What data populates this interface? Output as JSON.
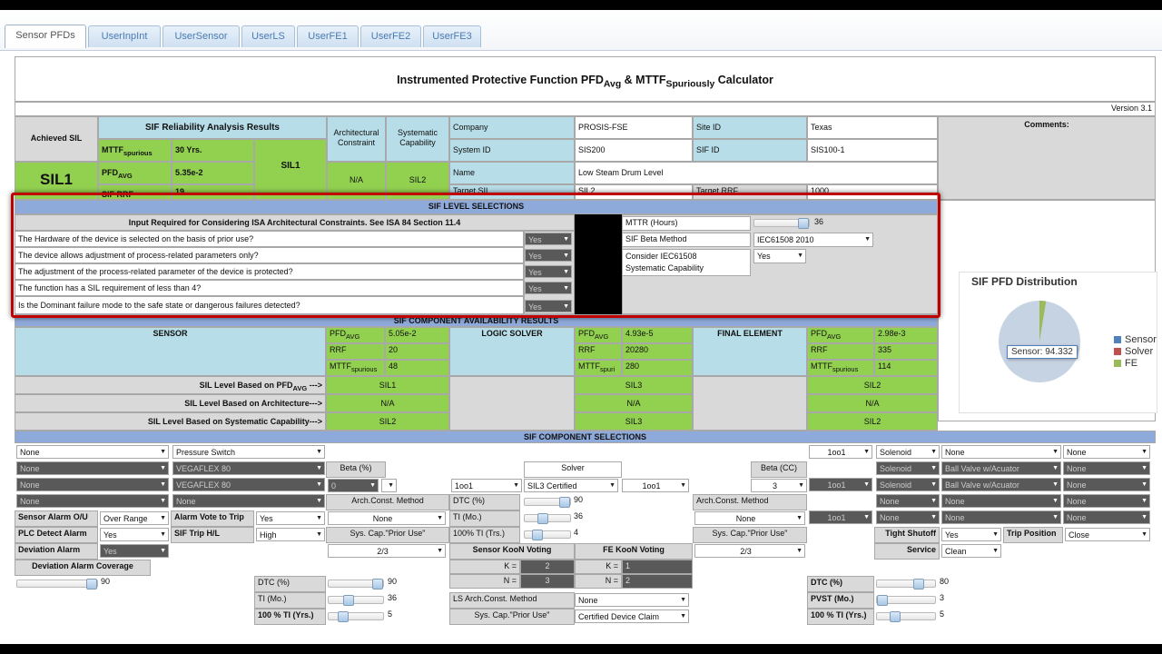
{
  "tabs": [
    "Sensor PFDs",
    "UserInpInt",
    "UserSensor",
    "UserLS",
    "UserFE1",
    "UserFE2",
    "UserFE3"
  ],
  "title": {
    "prefix": "Instrumented Protective Function PFD",
    "sub1": "Avg",
    "mid": " & MTTF",
    "sub2": "Spuriously",
    "suffix": " Calculator"
  },
  "version": "Version 3.1",
  "summary": {
    "achieved_sil_label": "Achieved SIL",
    "achieved_sil": "SIL1",
    "results_label": "SIF Reliability Analysis Results",
    "mttf_label": "MTTF",
    "mttf_sub": "spurious",
    "mttf_value": "30 Yrs.",
    "pfd_label": "PFD",
    "pfd_sub": "AVG",
    "pfd_value": "5.35e-2",
    "sil_value": "SIL1",
    "rrf_label": "SIF RRF",
    "rrf_value": "19",
    "arch_label": "Architectural Constraint",
    "arch_value": "N/A",
    "sys_label": "Systematic Capability",
    "sys_value": "SIL2"
  },
  "info": {
    "company_label": "Company",
    "company": "PROSIS-FSE",
    "site_label": "Site ID",
    "site": "Texas",
    "system_label": "System ID",
    "system": "SIS200",
    "sif_label": "SIF ID",
    "sif": "SIS100-1",
    "name_label": "Name",
    "name": "Low Steam Drum Level",
    "target_label": "Target SIL",
    "target": "SIL2",
    "target_rrf_label": "Target RRF",
    "target_rrf": "1000",
    "comments_label": "Comments:"
  },
  "sel": {
    "header": "SIF LEVEL SELECTIONS",
    "isa_note": "Input Required for Considering ISA Architectural Constraints. See ISA 84  Section 11.4",
    "questions": [
      "The Hardware of the device is selected on the basis of prior use?",
      "The device allows adjustment of process-related parameters only?",
      "The adjustment of the process-related parameter of the device is protected?",
      "The function has a SIL requirement of less than 4?",
      "Is the Dominant failure mode to the safe state or dangerous failures detected?"
    ],
    "answers": [
      "Yes",
      "Yes",
      "Yes",
      "Yes",
      "Yes"
    ],
    "mttr_label": "MTTR (Hours)",
    "mttr": "36",
    "beta_label": "SIF Beta Method",
    "beta": "IEC61508 2010",
    "consider_label1": "Consider IEC61508",
    "consider_label2": "Systematic Capability",
    "consider": "Yes"
  },
  "pie": {
    "title": "SIF PFD Distribution",
    "tooltip": "Sensor: 94.332",
    "legend": [
      {
        "name": "Sensor",
        "color": "#4f81bd"
      },
      {
        "name": "Solver",
        "color": "#c0504d"
      },
      {
        "name": "FE",
        "color": "#9bbb59"
      }
    ]
  },
  "avail": {
    "header": "SIF COMPONENT AVAILABILITY RESULTS",
    "sensor": "SENSOR",
    "solver": "LOGIC SOLVER",
    "fe": "FINAL ELEMENT",
    "pfd": "PFD",
    "pfd_sub": "AVG",
    "rrf": "RRF",
    "mttf": "MTTF",
    "mttf_sub": "spurious",
    "mttf_sub2": "spuri",
    "s_pfd": "5.05e-2",
    "s_rrf": "20",
    "s_mttf": "48",
    "l_pfd": "4.93e-5",
    "l_rrf": "20280",
    "l_mttf": "280",
    "f_pfd": "2.98e-3",
    "f_rrf": "335",
    "f_mttf": "114",
    "row1": "SIL Level Based on PFD",
    "row1_sub": "AVG",
    "row1_tail": " --->",
    "row2": "SIL Level Based on Architecture--->",
    "row3": "SIL Level Based on Systematic Capability--->",
    "s_sil": [
      "SIL1",
      "N/A",
      "SIL2"
    ],
    "l_sil": [
      "SIL3",
      "N/A",
      "SIL3"
    ],
    "f_sil": [
      "SIL2",
      "N/A",
      "SIL2"
    ]
  },
  "comp": {
    "header": "SIF COMPONENT SELECTIONS",
    "none": "None",
    "pressure_switch": "Pressure Switch",
    "vegaflex": "VEGAFLEX 80",
    "beta_pct": "Beta (%)",
    "beta_val": "0",
    "arch_method": "Arch.Const. Method",
    "dtc": "DTC (%)",
    "dtc_val": "90",
    "ti": "TI (Mo.)",
    "ti_val": "36",
    "ti100": "100% TI (Trs.)",
    "ti100_val": "4",
    "sys_cap": "Sys. Cap.\"Prior Use\"",
    "voting": "2/3",
    "solver": "Solver",
    "solver_arch": "1oo1",
    "solver_cert": "SIL3 Certified",
    "sensor_alarm": "Sensor Alarm O/U",
    "over_range": "Over Range",
    "alarm_vote": "Alarm Vote to Trip",
    "yes": "Yes",
    "plc_alarm": "PLC Detect Alarm",
    "sif_trip": "SIF Trip H/L",
    "high": "High",
    "dev_alarm": "Deviation Alarm",
    "dev_cov": "Deviation Alarm Coverage",
    "dev_cov_val": "90",
    "sensor_koon": "Sensor KooN Voting",
    "fe_koon": "FE KooN Voting",
    "k": "K =",
    "n": "N =",
    "sk": "2",
    "sn": "3",
    "fk": "1",
    "fn": "2",
    "dtc2": "DTC (%)",
    "dtc2_val": "90",
    "ti2": "TI (Mo.)",
    "ti2_val": "36",
    "ti1002": "100 % TI (Yrs.)",
    "ti1002_val": "5",
    "ls_arch": "LS Arch.Const. Method",
    "ls_sys": "Sys. Cap.\"Prior Use\"",
    "cert_claim": "Certified Device Claim",
    "fe_beta": "Beta (CC)",
    "fe_beta_val": "3",
    "oneoo1": "1oo1",
    "solenoid": "Solenoid",
    "ball_valve": "Ball Valve w/Acuator",
    "tight": "Tight Shutoff",
    "trip_pos": "Trip Position",
    "close": "Close",
    "service": "Service",
    "clean": "Clean",
    "fe_dtc": "DTC (%)",
    "fe_dtc_val": "80",
    "pvst": "PVST (Mo.)",
    "pvst_val": "3",
    "fe_ti": "100 % TI (Yrs.)",
    "fe_ti_val": "5"
  }
}
